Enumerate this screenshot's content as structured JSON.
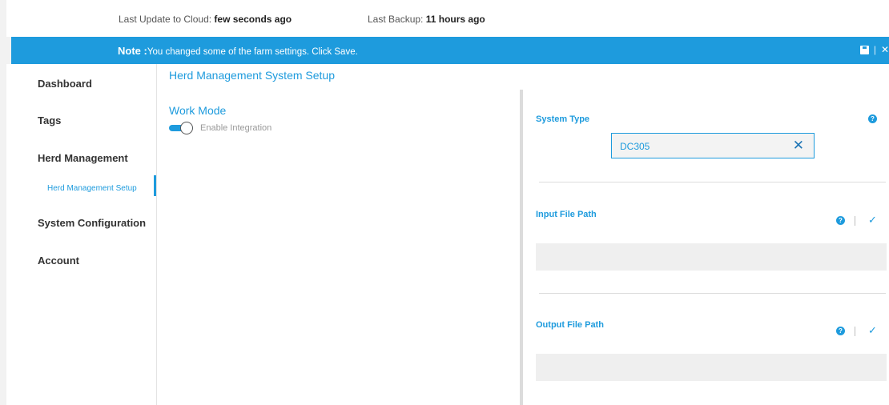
{
  "status": {
    "cloud_label": "Last Update to Cloud:",
    "cloud_value": "few seconds ago",
    "backup_label": "Last Backup:",
    "backup_value": "11 hours ago"
  },
  "note": {
    "prefix": "Note :",
    "message": "You changed some of the farm settings. Click Save.",
    "separator": "|",
    "close_glyph": "✕",
    "save_icon": "save-icon"
  },
  "sidebar": {
    "items": [
      {
        "label": "Dashboard"
      },
      {
        "label": "Tags"
      },
      {
        "label": "Herd Management"
      },
      {
        "label": "Herd Management Setup",
        "active": true
      },
      {
        "label": "System Configuration"
      },
      {
        "label": "Account"
      }
    ]
  },
  "main": {
    "title": "Herd Management System Setup",
    "work_mode": {
      "heading": "Work Mode",
      "toggle_label": "Enable Integration",
      "toggle_on": true
    }
  },
  "panel": {
    "system_type": {
      "label": "System Type",
      "value": "DC305",
      "help_glyph": "?",
      "clear_glyph": "✕"
    },
    "input_path": {
      "label": "Input File Path",
      "value": "",
      "help_glyph": "?",
      "check_glyph": "✓"
    },
    "output_path": {
      "label": "Output File Path",
      "value": "",
      "help_glyph": "?",
      "check_glyph": "✓"
    }
  },
  "colors": {
    "accent": "#1e9bdd",
    "background": "#f2f2f2",
    "panel_border": "#dcdcdc"
  }
}
